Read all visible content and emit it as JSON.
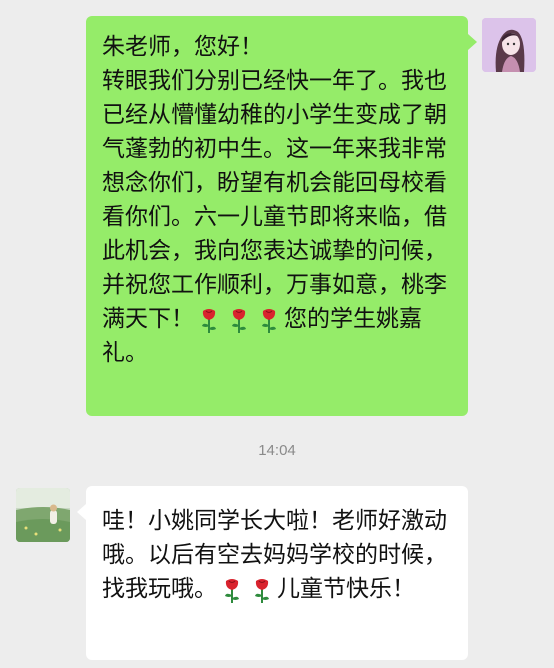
{
  "chat": {
    "timestamp": "14:04",
    "outgoing": {
      "text": "朱老师，您好！\n转眼我们分别已经快一年了。我也已经从懵懂幼稚的小学生变成了朝气蓬勃的初中生。这一年来我非常想念你们，盼望有机会能回母校看看你们。六一儿童节即将来临，借此机会，我向您表达诚挚的问候，并祝您工作顺利，万事如意，桃李满天下！",
      "end_text": "您的学生姚嘉礼。",
      "emoji": [
        "rose-emoji",
        "rose-emoji",
        "rose-emoji"
      ]
    },
    "incoming": {
      "text": "哇！小姚同学长大啦！老师好激动哦。以后有空去妈妈学校的时候，找我玩哦。",
      "end_text": "儿童节快乐！",
      "emoji": [
        "rose-emoji",
        "rose-emoji"
      ]
    }
  },
  "colors": {
    "background": "#ededed",
    "outgoing_bubble": "#95ec69",
    "incoming_bubble": "#ffffff",
    "timestamp": "#8a8a8a"
  }
}
